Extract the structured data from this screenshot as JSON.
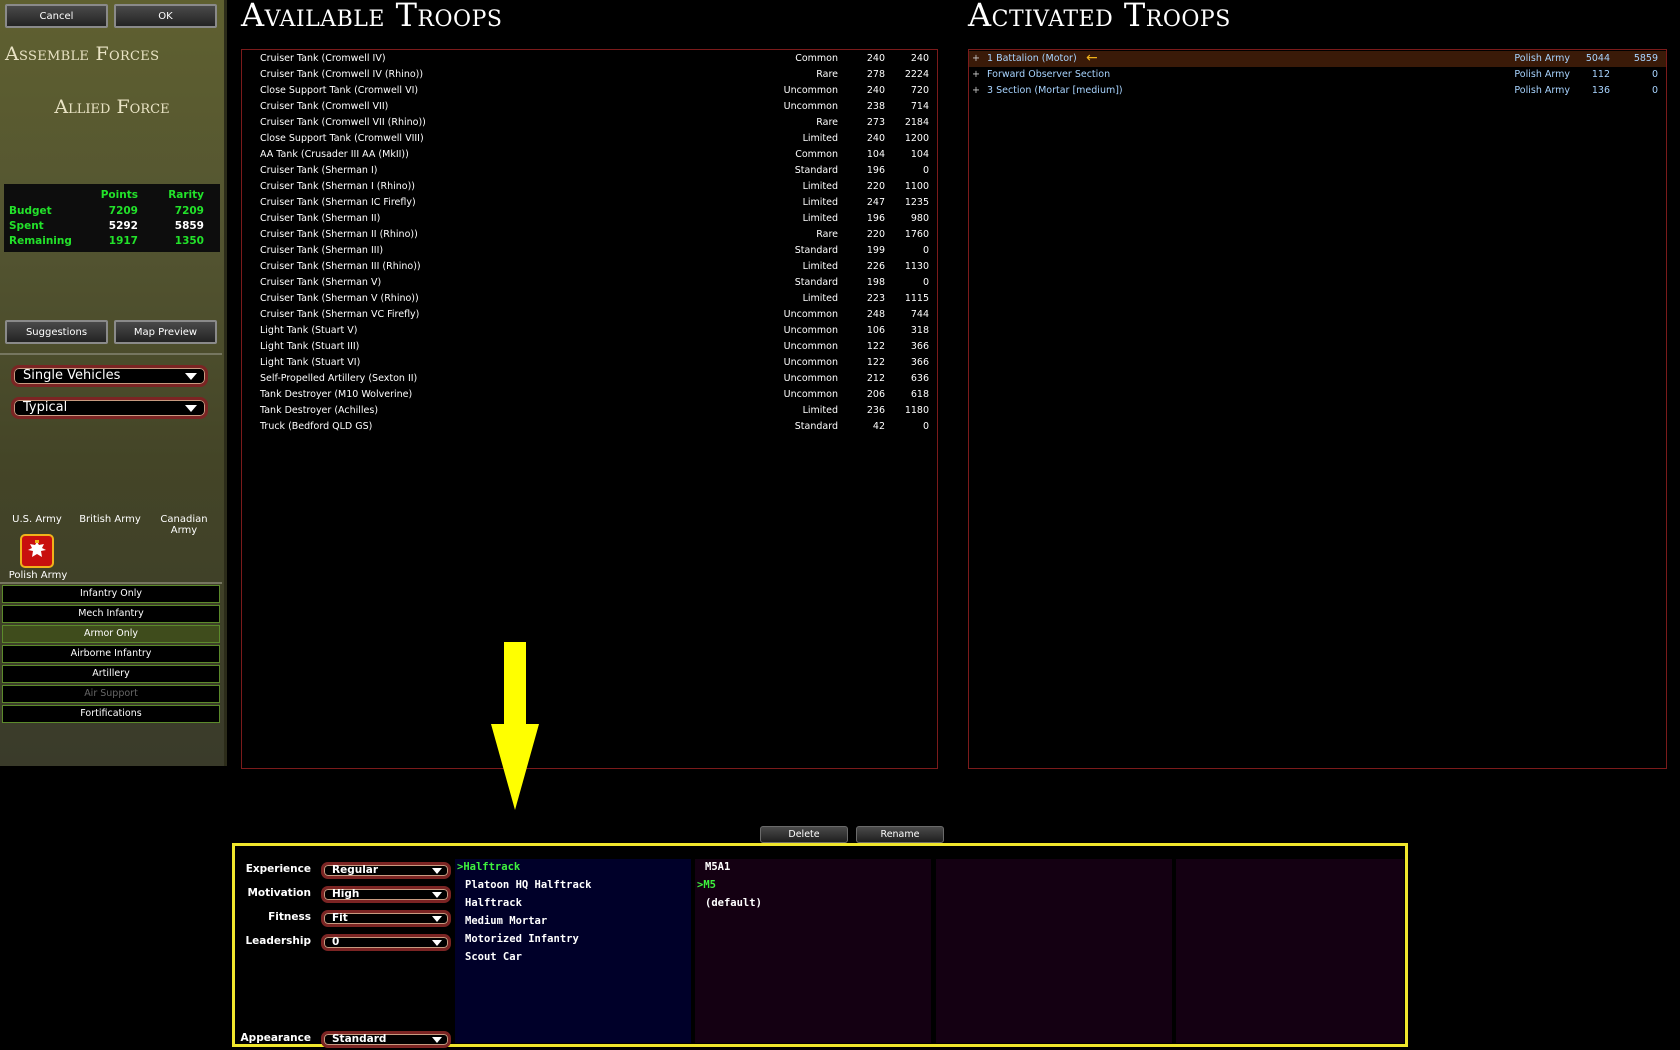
{
  "header_buttons": {
    "cancel": "Cancel",
    "ok": "OK"
  },
  "left": {
    "assemble_title": "Assemble Forces",
    "force_name": "Allied Force",
    "budget": {
      "col_points": "Points",
      "col_rarity": "Rarity",
      "rows": [
        {
          "label": "Budget",
          "points": "7209",
          "rarity": "7209"
        },
        {
          "label": "Spent",
          "points": "5292",
          "rarity": "5859"
        },
        {
          "label": "Remaining",
          "points": "1917",
          "rarity": "1350"
        }
      ]
    },
    "suggestions": "Suggestions",
    "map_preview": "Map Preview",
    "unit_type_select": "Single Vehicles",
    "quality_select": "Typical",
    "nations": [
      "U.S. Army",
      "British Army",
      "Canadian Army",
      "Polish Army"
    ],
    "categories": [
      {
        "label": "Infantry Only",
        "state": "normal"
      },
      {
        "label": "Mech Infantry",
        "state": "normal"
      },
      {
        "label": "Armor Only",
        "state": "active"
      },
      {
        "label": "Airborne Infantry",
        "state": "normal"
      },
      {
        "label": "Artillery",
        "state": "normal"
      },
      {
        "label": "Air Support",
        "state": "disabled"
      },
      {
        "label": "Fortifications",
        "state": "normal"
      }
    ]
  },
  "available": {
    "title": "Available Troops",
    "rows": [
      {
        "name": "Cruiser Tank (Cromwell IV)",
        "rarity": "Common",
        "points": "240",
        "cost": "240"
      },
      {
        "name": "Cruiser Tank (Cromwell IV (Rhino))",
        "rarity": "Rare",
        "points": "278",
        "cost": "2224"
      },
      {
        "name": "Close Support Tank (Cromwell VI)",
        "rarity": "Uncommon",
        "points": "240",
        "cost": "720"
      },
      {
        "name": "Cruiser Tank (Cromwell VII)",
        "rarity": "Uncommon",
        "points": "238",
        "cost": "714"
      },
      {
        "name": "Cruiser Tank (Cromwell VII (Rhino))",
        "rarity": "Rare",
        "points": "273",
        "cost": "2184"
      },
      {
        "name": "Close Support Tank (Cromwell VIII)",
        "rarity": "Limited",
        "points": "240",
        "cost": "1200"
      },
      {
        "name": "AA Tank (Crusader III AA (MkII))",
        "rarity": "Common",
        "points": "104",
        "cost": "104"
      },
      {
        "name": "Cruiser Tank (Sherman I)",
        "rarity": "Standard",
        "points": "196",
        "cost": "0"
      },
      {
        "name": "Cruiser Tank (Sherman I (Rhino))",
        "rarity": "Limited",
        "points": "220",
        "cost": "1100"
      },
      {
        "name": "Cruiser Tank (Sherman IC Firefly)",
        "rarity": "Limited",
        "points": "247",
        "cost": "1235"
      },
      {
        "name": "Cruiser Tank (Sherman II)",
        "rarity": "Limited",
        "points": "196",
        "cost": "980"
      },
      {
        "name": "Cruiser Tank (Sherman II (Rhino))",
        "rarity": "Rare",
        "points": "220",
        "cost": "1760"
      },
      {
        "name": "Cruiser Tank (Sherman III)",
        "rarity": "Standard",
        "points": "199",
        "cost": "0"
      },
      {
        "name": "Cruiser Tank (Sherman III (Rhino))",
        "rarity": "Limited",
        "points": "226",
        "cost": "1130"
      },
      {
        "name": "Cruiser Tank (Sherman V)",
        "rarity": "Standard",
        "points": "198",
        "cost": "0"
      },
      {
        "name": "Cruiser Tank (Sherman V (Rhino))",
        "rarity": "Limited",
        "points": "223",
        "cost": "1115"
      },
      {
        "name": "Cruiser Tank (Sherman VC Firefly)",
        "rarity": "Uncommon",
        "points": "248",
        "cost": "744"
      },
      {
        "name": "Light Tank (Stuart V)",
        "rarity": "Uncommon",
        "points": "106",
        "cost": "318"
      },
      {
        "name": "Light Tank (Stuart III)",
        "rarity": "Uncommon",
        "points": "122",
        "cost": "366"
      },
      {
        "name": "Light Tank (Stuart VI)",
        "rarity": "Uncommon",
        "points": "122",
        "cost": "366"
      },
      {
        "name": "Self-Propelled Artillery (Sexton II)",
        "rarity": "Uncommon",
        "points": "212",
        "cost": "636"
      },
      {
        "name": "Tank Destroyer (M10 Wolverine)",
        "rarity": "Uncommon",
        "points": "206",
        "cost": "618"
      },
      {
        "name": "Tank Destroyer (Achilles)",
        "rarity": "Limited",
        "points": "236",
        "cost": "1180"
      },
      {
        "name": "Truck (Bedford QLD GS)",
        "rarity": "Standard",
        "points": "42",
        "cost": "0"
      }
    ]
  },
  "activated": {
    "title": "Activated Troops",
    "rows": [
      {
        "name": "1 Battalion (Motor)",
        "army": "Polish Army",
        "points": "5044",
        "cost": "5859",
        "selected": true
      },
      {
        "name": "Forward Observer Section",
        "army": "Polish Army",
        "points": "112",
        "cost": "0",
        "selected": false
      },
      {
        "name": "3 Section (Mortar [medium])",
        "army": "Polish Army",
        "points": "136",
        "cost": "0",
        "selected": false
      }
    ]
  },
  "actions": {
    "delete": "Delete",
    "rename": "Rename"
  },
  "details": {
    "attributes": [
      {
        "label": "Experience",
        "value": "Regular"
      },
      {
        "label": "Motivation",
        "value": "High"
      },
      {
        "label": "Fitness",
        "value": "Fit"
      },
      {
        "label": "Leadership",
        "value": "0"
      }
    ],
    "appearance": {
      "label": "Appearance",
      "value": "Standard"
    },
    "unit_list": [
      {
        "label": "Halftrack",
        "selected": true
      },
      {
        "label": "Platoon HQ Halftrack",
        "selected": false
      },
      {
        "label": "Halftrack",
        "selected": false
      },
      {
        "label": "Medium Mortar",
        "selected": false
      },
      {
        "label": "Motorized Infantry",
        "selected": false
      },
      {
        "label": "Scout Car",
        "selected": false
      }
    ],
    "variant_list": [
      {
        "label": "M5A1",
        "selected": false
      },
      {
        "label": "M5",
        "selected": true
      },
      {
        "label": "(default)",
        "selected": false
      }
    ]
  },
  "colors": {
    "highlight_green": "#3ef23e",
    "frame_yellow": "#f0e62c",
    "panel_border_red": "#7b1b1b",
    "annotation_arrow": "#ffff00"
  },
  "icons": {
    "selected_row_marker": "arrow-left-icon",
    "polish_flag": "polish-eagle-icon"
  }
}
